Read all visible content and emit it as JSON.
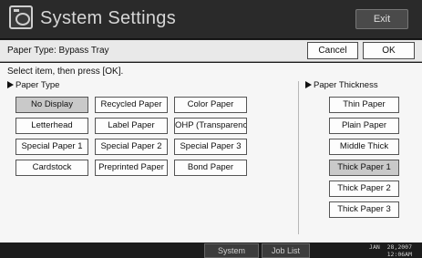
{
  "window": {
    "title": "System Settings",
    "exit_label": "Exit",
    "icon": "copier-settings-icon"
  },
  "header": {
    "title": "Paper Type: Bypass Tray",
    "cancel_label": "Cancel",
    "ok_label": "OK"
  },
  "main": {
    "instruction": "Select item, then press [OK].",
    "paper_type": {
      "label": "Paper Type",
      "selected": "No Display",
      "items": [
        "No Display",
        "Recycled Paper",
        "Color Paper",
        "Letterhead",
        "Label Paper",
        "OHP (Transparency)",
        "Special Paper 1",
        "Special Paper 2",
        "Special Paper 3",
        "Cardstock",
        "Preprinted Paper",
        "Bond Paper"
      ]
    },
    "paper_thickness": {
      "label": "Paper Thickness",
      "selected": "Thick Paper 1",
      "items": [
        "Thin Paper",
        "Plain Paper",
        "Middle Thick",
        "Thick Paper 1",
        "Thick Paper 2",
        "Thick Paper 3"
      ]
    }
  },
  "bottom": {
    "system_status_label": "System Status",
    "job_list_label": "Job List",
    "date": "JAN  28,2007",
    "time": "12:06AM"
  }
}
